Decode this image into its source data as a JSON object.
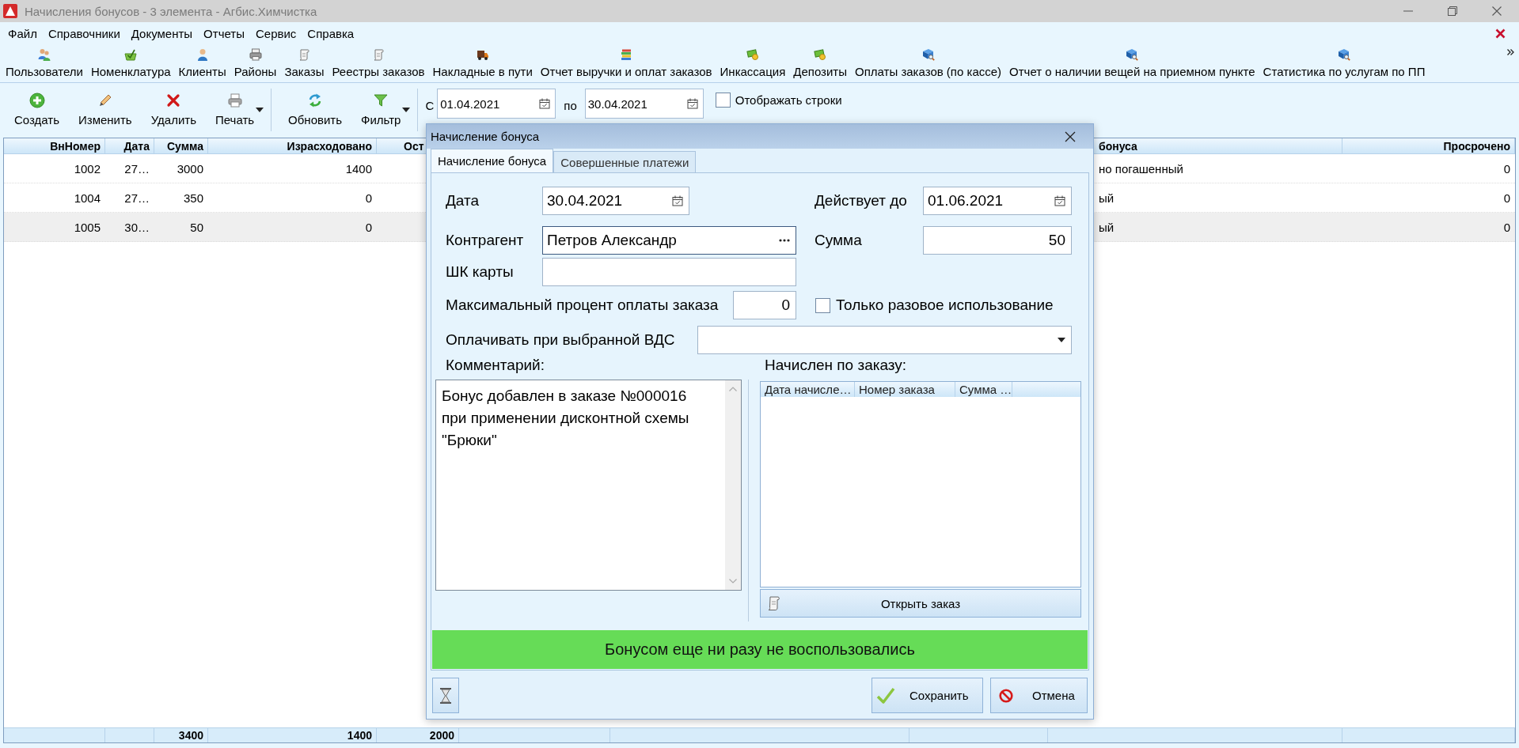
{
  "window": {
    "title": "Начисления бонусов - 3 элемента - Агбис.Химчистка"
  },
  "menu": [
    "Файл",
    "Справочники",
    "Документы",
    "Отчеты",
    "Сервис",
    "Справка"
  ],
  "quick_launch": [
    {
      "label": "Пользователи"
    },
    {
      "label": "Номенклатура"
    },
    {
      "label": "Клиенты"
    },
    {
      "label": "Районы"
    },
    {
      "label": "Заказы"
    },
    {
      "label": "Реестры заказов"
    },
    {
      "label": "Накладные в пути"
    },
    {
      "label": "Отчет выручки и оплат заказов"
    },
    {
      "label": "Инкассация"
    },
    {
      "label": "Депозиты"
    },
    {
      "label": "Оплаты заказов (по кассе)"
    },
    {
      "label": "Отчет о наличии вещей на приемном пункте"
    },
    {
      "label": "Статистика по услугам по ПП"
    }
  ],
  "toolbar": {
    "button_groups": [
      [
        {
          "label": "Создать",
          "dropdown": false
        },
        {
          "label": "Изменить",
          "dropdown": false
        },
        {
          "label": "Удалить",
          "dropdown": false
        },
        {
          "label": "Печать",
          "dropdown": true
        }
      ],
      [
        {
          "label": "Обновить",
          "dropdown": false
        },
        {
          "label": "Фильтр",
          "dropdown": true
        }
      ]
    ],
    "period": {
      "from_label": "С",
      "from": "01.04.2021",
      "to_label": "по",
      "to": "30.04.2021"
    },
    "show_rows": {
      "label": "Отображать строки",
      "checked": false
    }
  },
  "table": {
    "columns": {
      "vn_number": "ВнНомер",
      "date": "Дата",
      "sum": "Сумма",
      "spent": "Израсходовано",
      "column_5": "Ост",
      "column_9": "бонуса",
      "overdue": "Просрочено"
    },
    "rows": [
      {
        "vn_number": "1002",
        "date": "27…",
        "sum": "3000",
        "spent": "1400",
        "column_9": "но погашенный",
        "overdue": "0",
        "selected": false
      },
      {
        "vn_number": "1004",
        "date": "27…",
        "sum": "350",
        "spent": "0",
        "column_9": "ый",
        "overdue": "0",
        "selected": false
      },
      {
        "vn_number": "1005",
        "date": "30…",
        "sum": "50",
        "spent": "0",
        "column_9": "ый",
        "overdue": "0",
        "selected": true
      }
    ],
    "totals": {
      "sum": "3400",
      "spent": "1400",
      "column_5": "2000"
    }
  },
  "dialog": {
    "title": "Начисление бонуса",
    "tabs": [
      {
        "label": "Начисление бонуса",
        "selected": true
      },
      {
        "label": "Совершенные платежи",
        "selected": false
      }
    ],
    "date": {
      "label": "Дата",
      "value": "30.04.2021"
    },
    "valid_until": {
      "label": "Действует до",
      "value": "01.06.2021"
    },
    "counterparty": {
      "label": "Контрагент",
      "value": "Петров Александр",
      "focused": true
    },
    "amount": {
      "label": "Сумма",
      "value": "50"
    },
    "card_barcode": {
      "label": "ШК карты"
    },
    "max_payment_percent": {
      "label": "Максимальный процент оплаты заказа",
      "value": "0"
    },
    "one_time_use": {
      "label": "Только разовое использование",
      "checked": false
    },
    "pay_with_vds": {
      "label": "Оплачивать при выбранной ВДС"
    },
    "comment": {
      "label": "Комментарий:",
      "value": "Бонус добавлен в заказе №000016 при применении дисконтной схемы \"Брюки\""
    },
    "accrued_by_order": {
      "label": "Начислен по заказу:",
      "columns": [
        "Дата начисле…",
        "Номер заказа",
        "Сумма …"
      ],
      "open_button": "Открыть заказ"
    },
    "status_message": "Бонусом еще ни разу не воспользовались",
    "buttons": [
      {
        "label": "Сохранить",
        "kind": "save"
      },
      {
        "label": "Отмена",
        "kind": "cancel"
      }
    ]
  }
}
